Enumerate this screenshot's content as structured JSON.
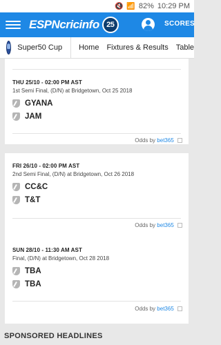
{
  "status_bar": {
    "battery": "82%",
    "time": "10:29 PM"
  },
  "topbar": {
    "logo_brand": "ESPN",
    "logo_site": "cricinfo",
    "logo_badge": "25",
    "scores_label": "SCORES"
  },
  "subnav": {
    "series_name": "Super50 Cup",
    "links": [
      "Home",
      "Fixtures & Results",
      "Table"
    ]
  },
  "matches": [
    {
      "date": "THU 25/10 - 02:00 PM AST",
      "detail": "1st Semi Final, (D/N) at Bridgetown, Oct 25 2018",
      "team1": "GYANA",
      "team2": "JAM",
      "odds_prefix": "Odds by",
      "odds_provider": "bet365"
    },
    {
      "date": "FRI 26/10 - 02:00 PM AST",
      "detail": "2nd Semi Final, (D/N) at Bridgetown, Oct 26 2018",
      "team1": "CC&C",
      "team2": "T&T",
      "odds_prefix": "Odds by",
      "odds_provider": "bet365"
    },
    {
      "date": "SUN 28/10 - 11:30 AM AST",
      "detail": "Final, (D/N) at Bridgetown, Oct 28 2018",
      "team1": "TBA",
      "team2": "TBA",
      "odds_prefix": "Odds by",
      "odds_provider": "bet365"
    }
  ],
  "footer": {
    "sponsored_label": "SPONSORED HEADLINES"
  },
  "colors": {
    "brand_blue": "#1e88e5",
    "link_blue": "#1e88e5"
  }
}
